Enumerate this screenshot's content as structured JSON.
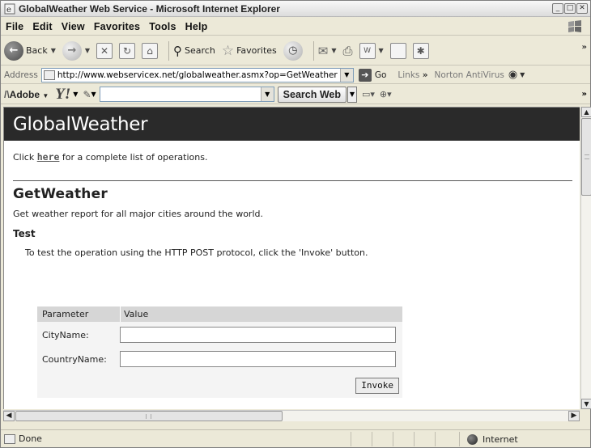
{
  "window": {
    "title": "GlobalWeather Web Service - Microsoft Internet Explorer",
    "controls": [
      "minimize",
      "maximize",
      "close"
    ]
  },
  "menubar": {
    "items": [
      "File",
      "Edit",
      "View",
      "Favorites",
      "Tools",
      "Help"
    ]
  },
  "toolbar": {
    "back_label": "Back",
    "search_label": "Search",
    "favorites_label": "Favorites"
  },
  "address": {
    "label": "Address",
    "url": "http://www.webservicex.net/globalweather.asmx?op=GetWeather",
    "go_label": "Go",
    "links_label": "Links",
    "links_chevron": "»",
    "norton_label": "Norton AntiVirus"
  },
  "searchbar": {
    "adobe_label": "Adobe",
    "yahoo_label": "Y!",
    "search_web_label": "Search Web"
  },
  "page": {
    "banner_title": "GlobalWeather",
    "intro_prefix": "Click ",
    "intro_link": "here",
    "intro_suffix": " for a complete list of operations.",
    "operation_title": "GetWeather",
    "operation_desc": "Get weather report for all major cities around the world.",
    "test_heading": "Test",
    "test_desc": "To test the operation using the HTTP POST protocol, click the 'Invoke' button.",
    "table": {
      "col_parameter": "Parameter",
      "col_value": "Value",
      "rows": [
        {
          "label": "CityName:",
          "value": ""
        },
        {
          "label": "CountryName:",
          "value": ""
        }
      ],
      "invoke_label": "Invoke"
    }
  },
  "status": {
    "text": "Done",
    "zone": "Internet"
  }
}
